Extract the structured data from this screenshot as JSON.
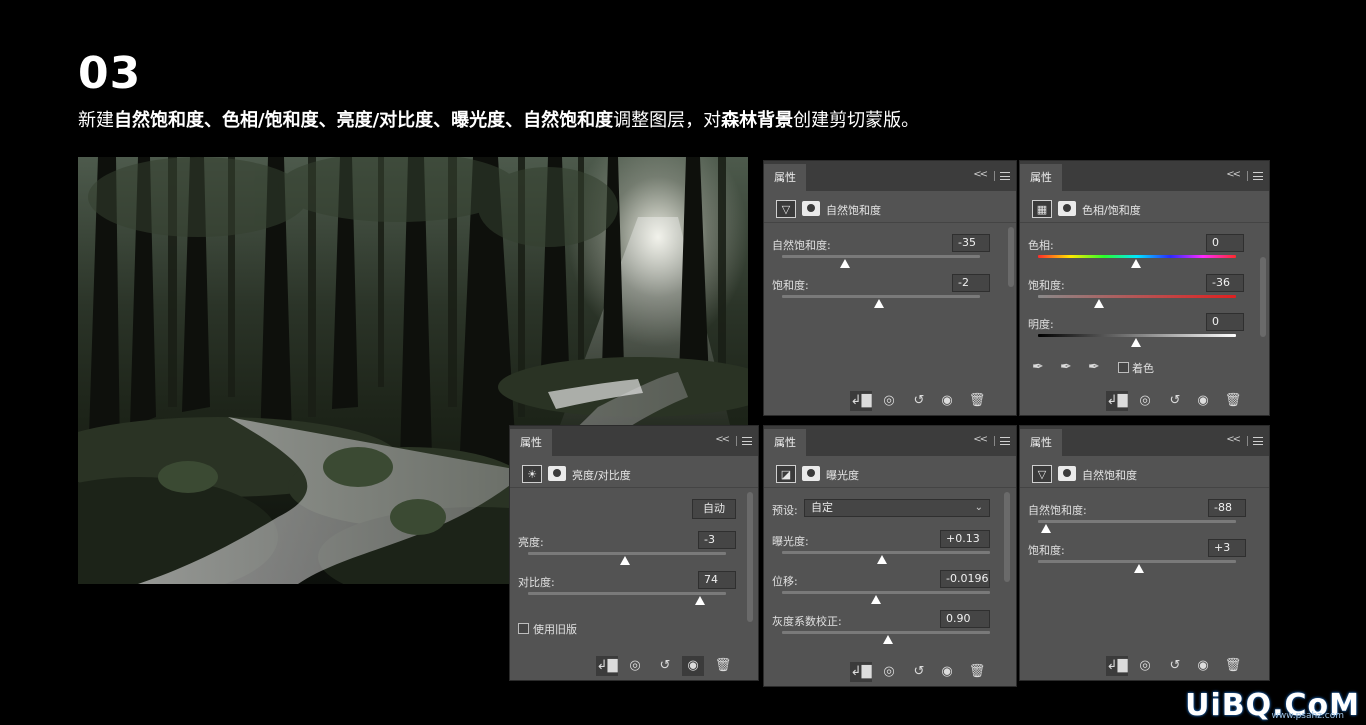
{
  "heading": {
    "number": "03",
    "parts": [
      {
        "text": "新建",
        "bold": false
      },
      {
        "text": "自然饱和度、色相/饱和度、亮度/对比度、曝光度、自然饱和度",
        "bold": true
      },
      {
        "text": "调整图层，对",
        "bold": false
      },
      {
        "text": "森林背景",
        "bold": true
      },
      {
        "text": "创建剪切蒙版。",
        "bold": false
      }
    ]
  },
  "panels": {
    "vibrance1": {
      "tab": "属性",
      "title": "自然饱和度",
      "vibrance_label": "自然饱和度:",
      "vibrance_value": "-35",
      "saturation_label": "饱和度:",
      "saturation_value": "-2"
    },
    "huesat": {
      "tab": "属性",
      "title": "色相/饱和度",
      "hue_label": "色相:",
      "hue_value": "0",
      "saturation_label": "饱和度:",
      "saturation_value": "-36",
      "lightness_label": "明度:",
      "lightness_value": "0",
      "colorize_label": "着色"
    },
    "brightness": {
      "tab": "属性",
      "title": "亮度/对比度",
      "auto_label": "自动",
      "brightness_label": "亮度:",
      "brightness_value": "-3",
      "contrast_label": "对比度:",
      "contrast_value": "74",
      "legacy_label": "使用旧版"
    },
    "exposure": {
      "tab": "属性",
      "title": "曝光度",
      "preset_label": "预设:",
      "preset_value": "自定",
      "exposure_label": "曝光度:",
      "exposure_value": "+0.13",
      "offset_label": "位移:",
      "offset_value": "-0.0196",
      "gamma_label": "灰度系数校正:",
      "gamma_value": "0.90"
    },
    "vibrance2": {
      "tab": "属性",
      "title": "自然饱和度",
      "vibrance_label": "自然饱和度:",
      "vibrance_value": "-88",
      "saturation_label": "饱和度:",
      "saturation_value": "+3"
    }
  },
  "icons": {
    "vibrance": "triangle-outline-icon",
    "huesat": "hue-saturation-icon",
    "brightness": "sun-icon",
    "exposure": "exposure-icon",
    "mask": "layer-mask-icon",
    "clip": "clip-to-layer-icon",
    "view_previous": "view-previous-state-icon",
    "reset": "reset-icon",
    "visibility": "eye-icon",
    "delete": "trash-icon"
  },
  "watermark": {
    "text": "UiBQ.CoM",
    "sub": "www.psahz.com"
  },
  "colors": {
    "panel_bg": "#535353",
    "panel_tab_bar": "#3c3c3c",
    "field_bg": "#454545",
    "page_bg": "#000000"
  }
}
